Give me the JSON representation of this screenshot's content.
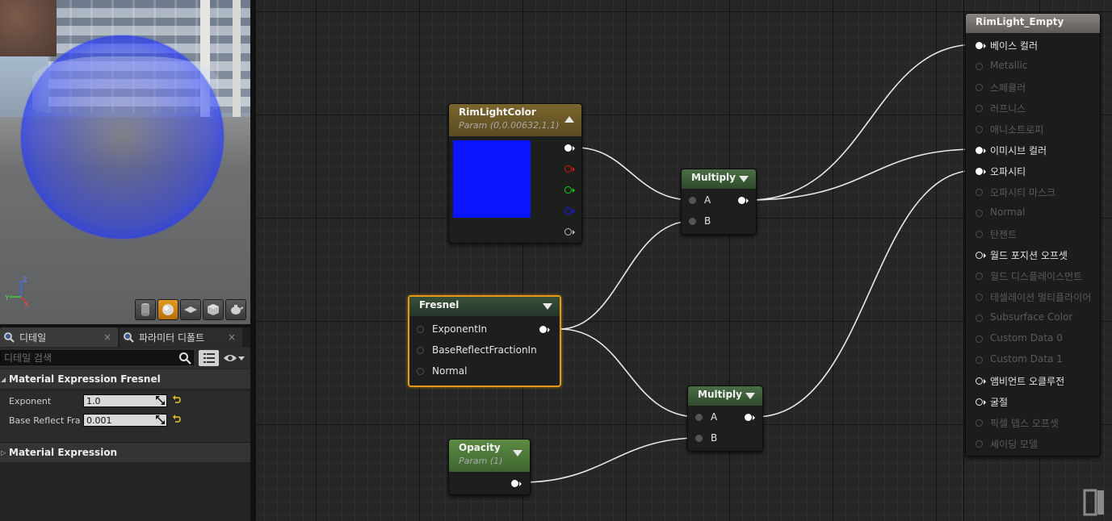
{
  "tabs": {
    "details": "디테일",
    "parameter_defaults": "파라미터 디폴트",
    "close": "×"
  },
  "search": {
    "placeholder": "디테일 검색"
  },
  "sections": {
    "fresnel": "Material Expression Fresnel",
    "expression": "Material Expression"
  },
  "properties": [
    {
      "label": "Exponent",
      "value": "1.0"
    },
    {
      "label": "Base Reflect Frac",
      "value": "0.001"
    }
  ],
  "axis": {
    "z": "Z",
    "y": "Y",
    "x": "X"
  },
  "nodes": {
    "rim_light_color": {
      "title": "RimLightColor",
      "subtitle": "Param (0,0.00632,1,1)",
      "swatch_color": "#0a14ff"
    },
    "multiply_1": {
      "title": "Multiply",
      "inputs": [
        "A",
        "B"
      ]
    },
    "multiply_2": {
      "title": "Multiply",
      "inputs": [
        "A",
        "B"
      ]
    },
    "fresnel": {
      "title": "Fresnel",
      "inputs": [
        "ExponentIn",
        "BaseReflectFractionIn",
        "Normal"
      ]
    },
    "opacity": {
      "title": "Opacity",
      "subtitle": "Param (1)"
    },
    "result": {
      "title": "RimLight_Empty",
      "pins": [
        {
          "label": "베이스 컬러",
          "state": "connected"
        },
        {
          "label": "Metallic",
          "state": "disabled"
        },
        {
          "label": "스페큘러",
          "state": "disabled"
        },
        {
          "label": "러프니스",
          "state": "disabled"
        },
        {
          "label": "애니소트로피",
          "state": "disabled"
        },
        {
          "label": "이미시브 컬러",
          "state": "connected"
        },
        {
          "label": "오파시티",
          "state": "connected"
        },
        {
          "label": "오파시티 마스크",
          "state": "disabled"
        },
        {
          "label": "Normal",
          "state": "disabled"
        },
        {
          "label": "탄젠트",
          "state": "disabled"
        },
        {
          "label": "월드 포지션 오프셋",
          "state": "enabled"
        },
        {
          "label": "월드 디스플레이스먼트",
          "state": "disabled"
        },
        {
          "label": "테셀레이션 멀티플라이어",
          "state": "disabled"
        },
        {
          "label": "Subsurface Color",
          "state": "disabled"
        },
        {
          "label": "Custom Data 0",
          "state": "disabled"
        },
        {
          "label": "Custom Data 1",
          "state": "disabled"
        },
        {
          "label": "앰비언트 오클루전",
          "state": "enabled"
        },
        {
          "label": "굴절",
          "state": "enabled"
        },
        {
          "label": "픽셀 뎁스 오프셋",
          "state": "disabled"
        },
        {
          "label": "셰이딩 모델",
          "state": "disabled"
        }
      ]
    }
  },
  "colors": {
    "accent_orange": "#e89a17",
    "pin_red": "#e01010",
    "pin_green": "#10d010",
    "pin_blue": "#1818ff"
  }
}
